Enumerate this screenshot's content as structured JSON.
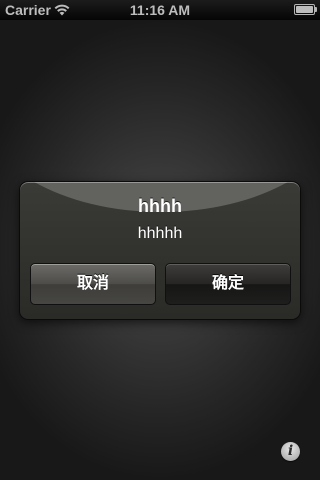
{
  "status_bar": {
    "carrier": "Carrier",
    "time": "11:16 AM",
    "battery_level": 1.0
  },
  "alert": {
    "title": "hhhh",
    "message": "hhhhh",
    "buttons": {
      "cancel": "取消",
      "confirm": "确定"
    }
  },
  "info_button": {
    "glyph": "i",
    "icon": "info-icon"
  }
}
